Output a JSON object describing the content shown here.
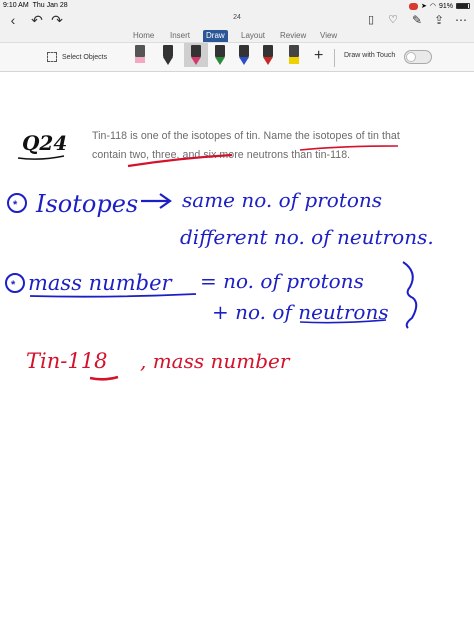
{
  "status_bar": {
    "time": "9:10 AM",
    "date": "Thu Jan 28",
    "battery": "91%",
    "battery_level": 0.91
  },
  "document": {
    "page_number": "24"
  },
  "ribbon_tabs": [
    "Home",
    "Insert",
    "Draw",
    "Layout",
    "Review",
    "View"
  ],
  "active_tab": "Draw",
  "toolbar": {
    "select_objects_label": "Select Objects",
    "draw_with_touch_label": "Draw with Touch"
  },
  "pen_colors": [
    "#333333",
    "#d23a6b",
    "#2a8a3a",
    "#2b4fc9",
    "#c62828",
    "#e6e600",
    "#f0c000"
  ],
  "question": {
    "label": "Q24",
    "text": "Tin-118 is one of the isotopes of tin. Name the isotopes of tin that contain two, three, and six more neutrons than tin-118."
  },
  "handwriting": {
    "line1a": "Isotopes",
    "line1b": "same no. of protons",
    "line2": "different no. of neutrons.",
    "line3a": "mass number",
    "line3b": "= no. of protons",
    "line4": "+ no. of neutrons",
    "line5a": "Tin-118",
    "line5b": ", mass number"
  },
  "colors": {
    "ink_black": "#111111",
    "ink_blue": "#1c1fc4",
    "ink_red": "#d3122c",
    "ribbon_active": "#2b5797"
  }
}
